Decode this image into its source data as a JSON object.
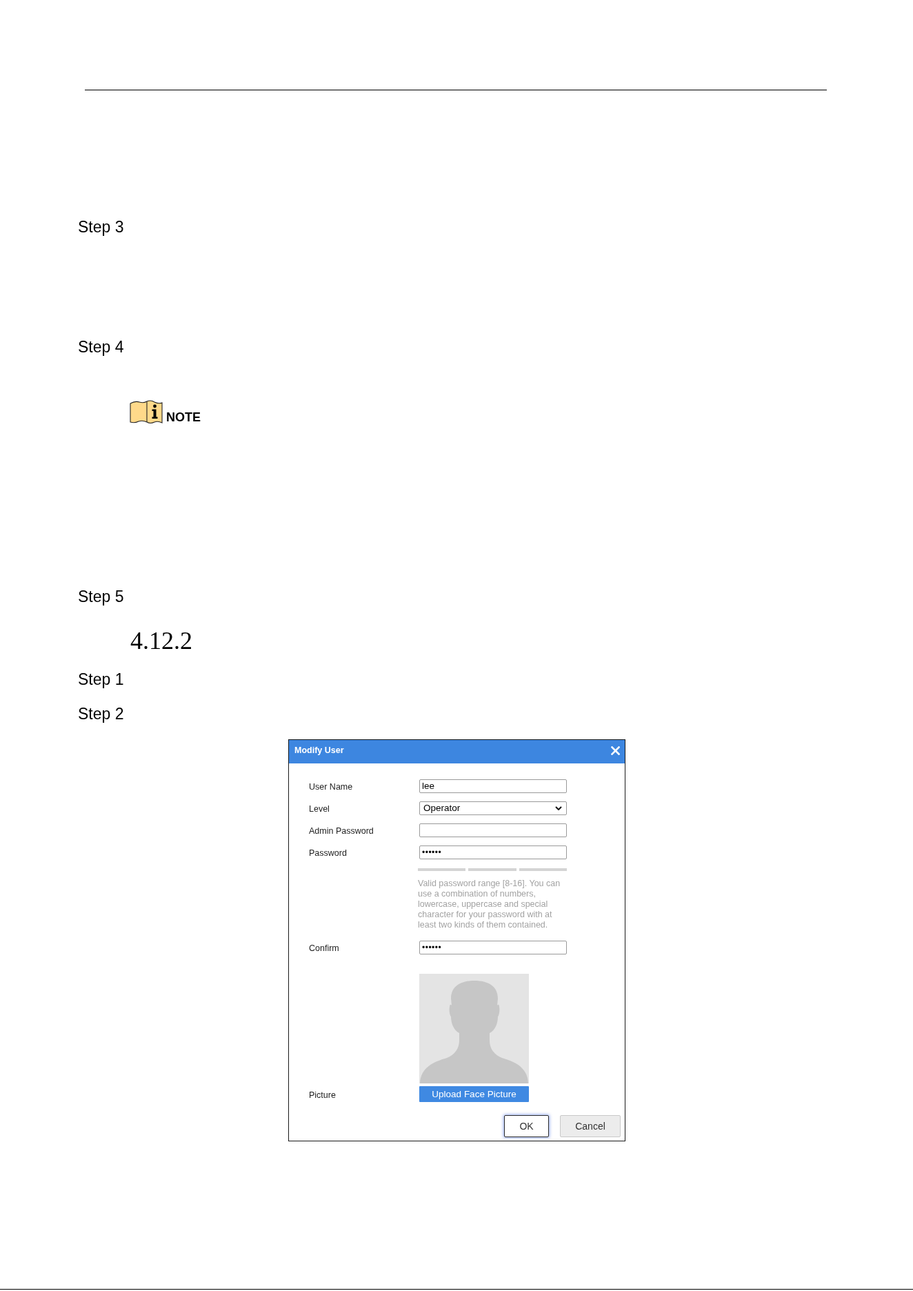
{
  "content": [
    {
      "kind": "step",
      "label": "Step 3"
    },
    {
      "kind": "step",
      "label": "Step 4"
    },
    {
      "kind": "note",
      "label": "NOTE"
    },
    {
      "kind": "step",
      "label": "Step 5"
    },
    {
      "kind": "heading",
      "label": "4.12.2"
    },
    {
      "kind": "step",
      "label": "Step 1"
    },
    {
      "kind": "step",
      "label": "Step 2"
    }
  ],
  "dialog": {
    "title": "Modify User",
    "fields": [
      {
        "kind": "text",
        "label": "User Name",
        "value": "lee"
      },
      {
        "kind": "select",
        "label": "Level",
        "value": "Operator"
      },
      {
        "kind": "password",
        "label": "Admin Password"
      },
      {
        "kind": "password",
        "label": "Password",
        "value": "••••••",
        "hint": "Valid password range [8-16]. You can use a combination of numbers, lowercase, uppercase and special character for your password with at least two kinds of them contained."
      },
      {
        "kind": "password",
        "label": "Confirm",
        "value": "••••••"
      },
      {
        "kind": "picture",
        "label": "Picture",
        "button": "Upload Face Picture"
      }
    ],
    "buttons": [
      {
        "label": "OK",
        "focused": true
      },
      {
        "label": "Cancel",
        "focused": false
      }
    ]
  }
}
